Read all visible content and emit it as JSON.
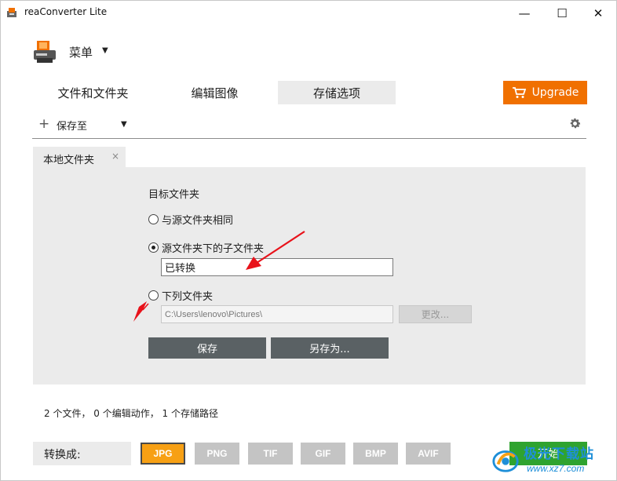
{
  "window": {
    "title": "reaConverter Lite",
    "minimize": "—",
    "maximize": "☐",
    "close": "✕"
  },
  "menu": {
    "label": "菜单",
    "caret": "▼"
  },
  "tabs": [
    {
      "label": "文件和文件夹"
    },
    {
      "label": "编辑图像"
    },
    {
      "label": "存储选项",
      "active": true
    }
  ],
  "upgrade": {
    "label": "Upgrade"
  },
  "toolbar": {
    "plus": "+",
    "save_to": "保存至",
    "caret": "▼"
  },
  "subtab": {
    "label": "本地文件夹",
    "close": "×"
  },
  "target": {
    "title": "目标文件夹",
    "options": [
      {
        "label": "与源文件夹相同",
        "checked": false
      },
      {
        "label": "源文件夹下的子文件夹",
        "checked": true
      },
      {
        "label": "下列文件夹",
        "checked": false
      }
    ],
    "subfolder_value": "已转换",
    "path_value": "C:\\Users\\lenovo\\Pictures\\",
    "change_label": "更改..."
  },
  "actions": {
    "save": "保存",
    "save_as": "另存为..."
  },
  "status": "2 个文件，  0 个编辑动作，  1 个存储路径",
  "bottom": {
    "convert_label": "转换成:",
    "formats": [
      "JPG",
      "PNG",
      "TIF",
      "GIF",
      "BMP",
      "AVIF"
    ],
    "selected_format": "JPG",
    "start_label": "开始"
  },
  "watermark": {
    "title": "极光下载站",
    "url": "www.xz7.com"
  },
  "colors": {
    "accent_orange": "#f07000",
    "format_selected": "#f7a014",
    "start_green": "#2fa32f",
    "annotation_red": "#e8121a"
  }
}
